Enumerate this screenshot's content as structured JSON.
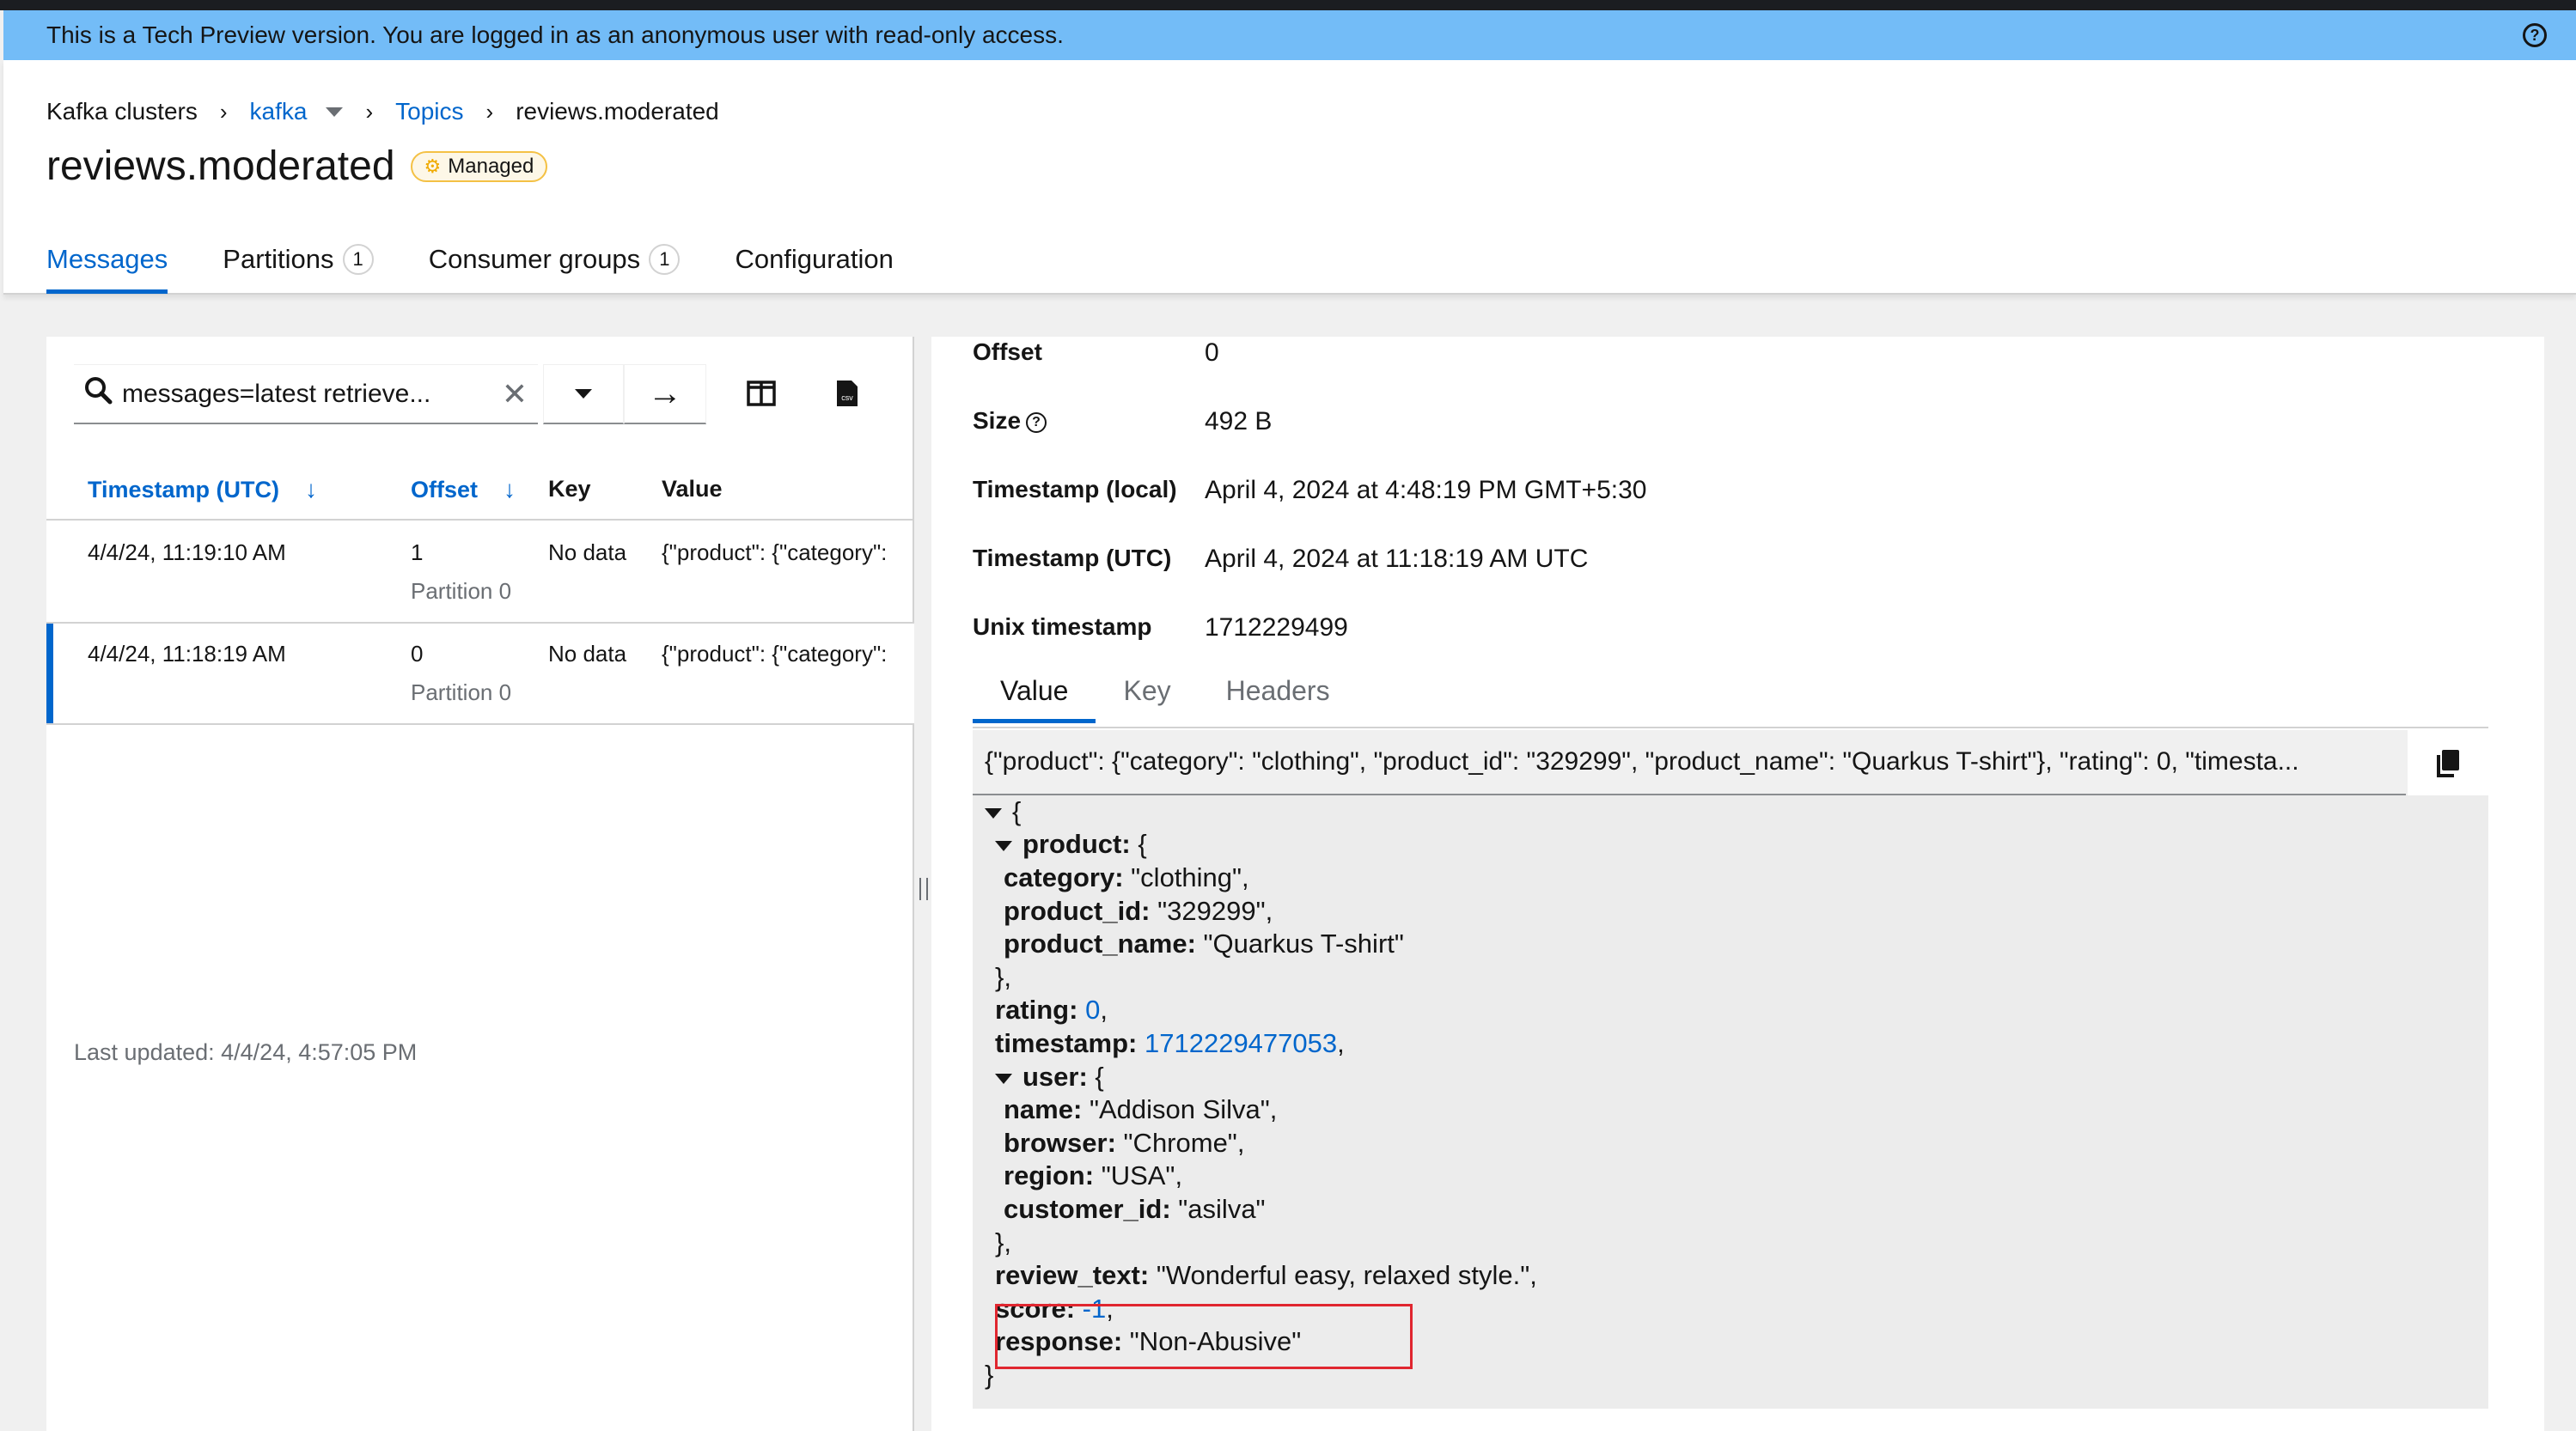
{
  "banner": {
    "text": "This is a Tech Preview version. You are logged in as an anonymous user with read-only access."
  },
  "breadcrumb": {
    "root": "Kafka clusters",
    "cluster": "kafka",
    "section": "Topics",
    "current": "reviews.moderated"
  },
  "page": {
    "title": "reviews.moderated",
    "badge": "Managed"
  },
  "tabs": [
    {
      "label": "Messages",
      "count": null,
      "active": true
    },
    {
      "label": "Partitions",
      "count": "1"
    },
    {
      "label": "Consumer groups",
      "count": "1"
    },
    {
      "label": "Configuration",
      "count": null
    }
  ],
  "search": {
    "value": "messages=latest retrieve..."
  },
  "table": {
    "columns": [
      "Timestamp (UTC)",
      "Offset",
      "Key",
      "Value"
    ],
    "rows": [
      {
        "timestamp": "4/4/24, 11:19:10 AM",
        "offset": "1",
        "partition": "Partition 0",
        "key": "No data",
        "value": "{\"product\": {\"category\":"
      },
      {
        "timestamp": "4/4/24, 11:18:19 AM",
        "offset": "0",
        "partition": "Partition 0",
        "key": "No data",
        "value": "{\"product\": {\"category\":"
      }
    ]
  },
  "last_updated": "Last updated: 4/4/24, 4:57:05 PM",
  "details": {
    "offset_label": "Offset",
    "offset": "0",
    "size_label": "Size",
    "size": "492 B",
    "ts_local_label": "Timestamp (local)",
    "ts_local": "April 4, 2024 at 4:48:19 PM GMT+5:30",
    "ts_utc_label": "Timestamp (UTC)",
    "ts_utc": "April 4, 2024 at 11:18:19 AM UTC",
    "unix_label": "Unix timestamp",
    "unix": "1712229499"
  },
  "detail_tabs": [
    "Value",
    "Key",
    "Headers"
  ],
  "raw_value": "{\"product\": {\"category\": \"clothing\", \"product_id\": \"329299\", \"product_name\": \"Quarkus T-shirt\"}, \"rating\": 0, \"timesta...",
  "json": {
    "open": "{",
    "product_key": "product:",
    "category_key": "category:",
    "category": "\"clothing\"",
    "product_id_key": "product_id:",
    "product_id": "\"329299\"",
    "product_name_key": "product_name:",
    "product_name": "\"Quarkus T-shirt\"",
    "close_obj": "},",
    "rating_key": "rating:",
    "rating": "0",
    "timestamp_key": "timestamp:",
    "timestamp": "1712229477053",
    "user_key": "user:",
    "name_key": "name:",
    "name": "\"Addison Silva\"",
    "browser_key": "browser:",
    "browser": "\"Chrome\"",
    "region_key": "region:",
    "region": "\"USA\"",
    "customer_id_key": "customer_id:",
    "customer_id": "\"asilva\"",
    "review_text_key": "review_text:",
    "review_text": "\"Wonderful easy, relaxed style.\"",
    "score_key": "score:",
    "score": "-1",
    "response_key": "response:",
    "response": "\"Non-Abusive\"",
    "close": "}"
  },
  "colors": {
    "accent": "#0066cc",
    "banner": "#73bcf7",
    "highlight": "#e0262f"
  }
}
